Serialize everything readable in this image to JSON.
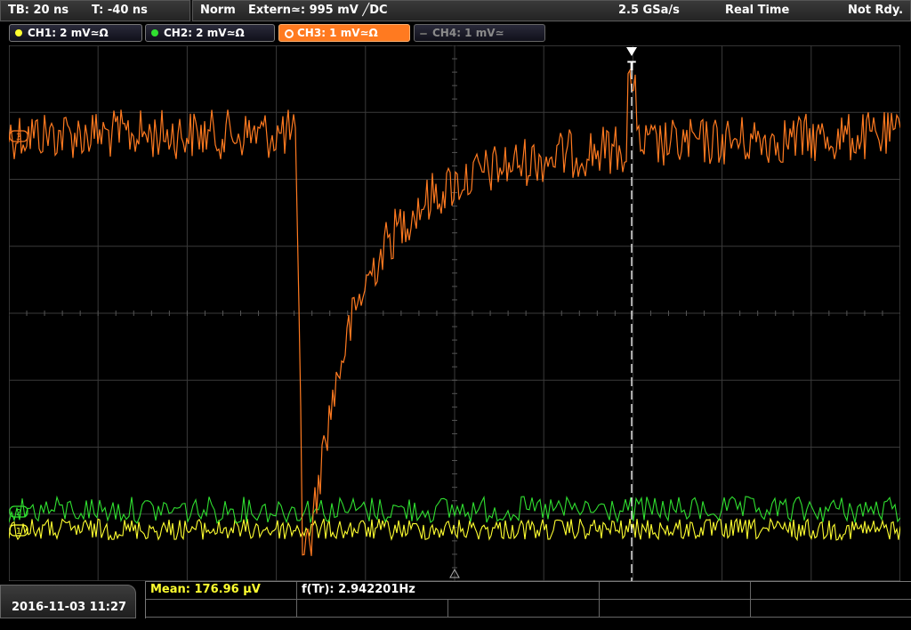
{
  "status": {
    "timebase": "TB: 20 ns",
    "trigger_offset": "T: -40 ns",
    "mode": "Norm",
    "trigger_source": "Extern≃: 995 mV ╱DC",
    "sample_rate": "2.5 GSa/s",
    "acq_mode": "Real Time",
    "run_state": "Not Rdy."
  },
  "channels": [
    {
      "label": "CH1: 2 mV≃Ω",
      "color": "#ffff30",
      "active": true
    },
    {
      "label": "CH2: 2 mV≃Ω",
      "color": "#30e030",
      "active": true
    },
    {
      "label": "CH3: 1 mV≃Ω",
      "color": "#ff7a20",
      "active": true,
      "selected": true
    },
    {
      "label": "CH4: 1 mV≃",
      "color": "#666666",
      "active": false
    }
  ],
  "markers": {
    "trigger": "T",
    "ch1": "1",
    "ch2": "2",
    "ch3": "3"
  },
  "footer": {
    "datetime": "2016-11-03 11:27"
  },
  "measurements": {
    "mean": "Mean: 176.96 µV",
    "trigger_frequency": "f(Tr): 2.942201Hz"
  }
}
